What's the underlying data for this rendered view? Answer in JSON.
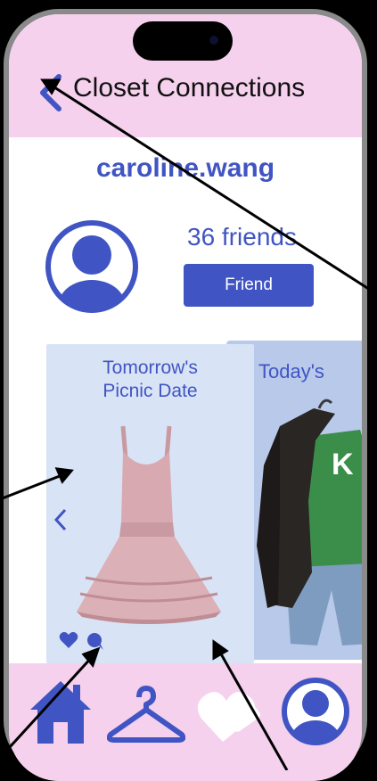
{
  "header": {
    "title": "Closet Connections"
  },
  "profile": {
    "username": "caroline.wang",
    "friends_count": "36 friends",
    "friend_button_label": "Friend"
  },
  "outfits": [
    {
      "title_line1": "Tomorrow's",
      "title_line2": "Picnic Date"
    },
    {
      "title": "Today's"
    }
  ],
  "bottom_nav": {
    "items": [
      "home-icon",
      "hanger-icon",
      "heart-icon",
      "profile-icon"
    ]
  },
  "colors": {
    "accent": "#4055c3",
    "header_bg": "#f5d1ed",
    "card_bg": "#d9e3f6",
    "card_back_bg": "#b8c9ea",
    "dress": "#d8a9b0"
  }
}
